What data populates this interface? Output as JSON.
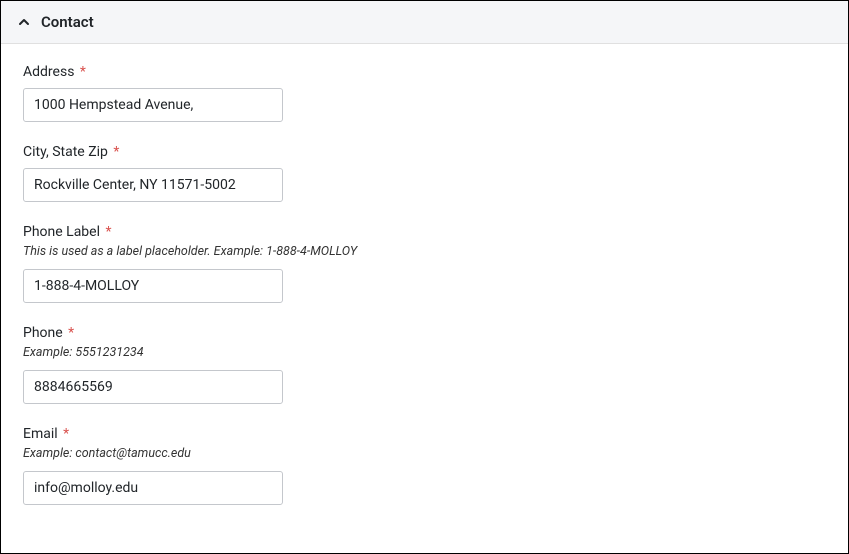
{
  "section": {
    "title": "Contact"
  },
  "fields": {
    "address": {
      "label": "Address",
      "value": "1000 Hempstead Avenue,"
    },
    "cityStateZip": {
      "label": "City, State Zip",
      "value": "Rockville Center, NY 11571-5002"
    },
    "phoneLabel": {
      "label": "Phone Label",
      "help": "This is used as a label placeholder. Example: 1-888-4-MOLLOY",
      "value": "1-888-4-MOLLOY"
    },
    "phone": {
      "label": "Phone",
      "help": "Example: 5551231234",
      "value": "8884665569"
    },
    "email": {
      "label": "Email",
      "help": "Example: contact@tamucc.edu",
      "value": "info@molloy.edu"
    }
  },
  "requiredMark": "*"
}
